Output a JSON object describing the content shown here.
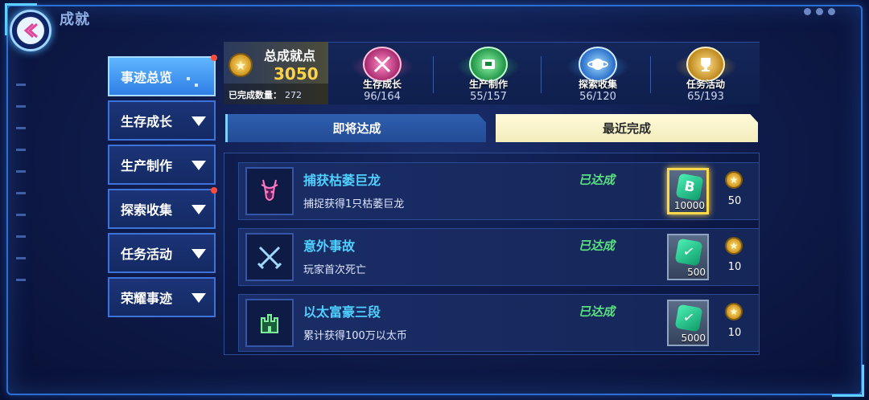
{
  "header": {
    "title": "成就"
  },
  "sidebar": {
    "items": [
      {
        "label": "事迹总览",
        "active": true,
        "badge": true
      },
      {
        "label": "生存成长",
        "active": false,
        "badge": false
      },
      {
        "label": "生产制作",
        "active": false,
        "badge": false
      },
      {
        "label": "探索收集",
        "active": false,
        "badge": true
      },
      {
        "label": "任务活动",
        "active": false,
        "badge": false
      },
      {
        "label": "荣耀事迹",
        "active": false,
        "badge": false
      }
    ]
  },
  "summary": {
    "label": "总成就点",
    "value": "3050",
    "completed_label": "已完成数量：",
    "completed_value": "272"
  },
  "categories": [
    {
      "name": "生存成长",
      "progress": "96/164",
      "color": "#e0479a",
      "icon": "crossed-swords-icon"
    },
    {
      "name": "生产制作",
      "progress": "55/157",
      "color": "#38d667",
      "icon": "machine-icon"
    },
    {
      "name": "探索收集",
      "progress": "56/120",
      "color": "#3fa6ff",
      "icon": "planet-icon"
    },
    {
      "name": "任务活动",
      "progress": "65/193",
      "color": "#f0b33a",
      "icon": "trophy-icon"
    }
  ],
  "tabs": {
    "upcoming": "即将达成",
    "recent": "最近完成"
  },
  "achievements": [
    {
      "title": "捕获枯萎巨龙",
      "desc": "捕捉获得1只枯萎巨龙",
      "status": "已达成",
      "reward_amount": "10000",
      "reward_icon": "b-coin-icon",
      "points": "50"
    },
    {
      "title": "意外事故",
      "desc": "玩家首次死亡",
      "status": "已达成",
      "reward_amount": "500",
      "reward_icon": "check-gem-icon",
      "points": "10"
    },
    {
      "title": "以太富豪三段",
      "desc": "累计获得100万以太币",
      "status": "已达成",
      "reward_amount": "5000",
      "reward_icon": "check-gem-icon",
      "points": "10"
    }
  ]
}
